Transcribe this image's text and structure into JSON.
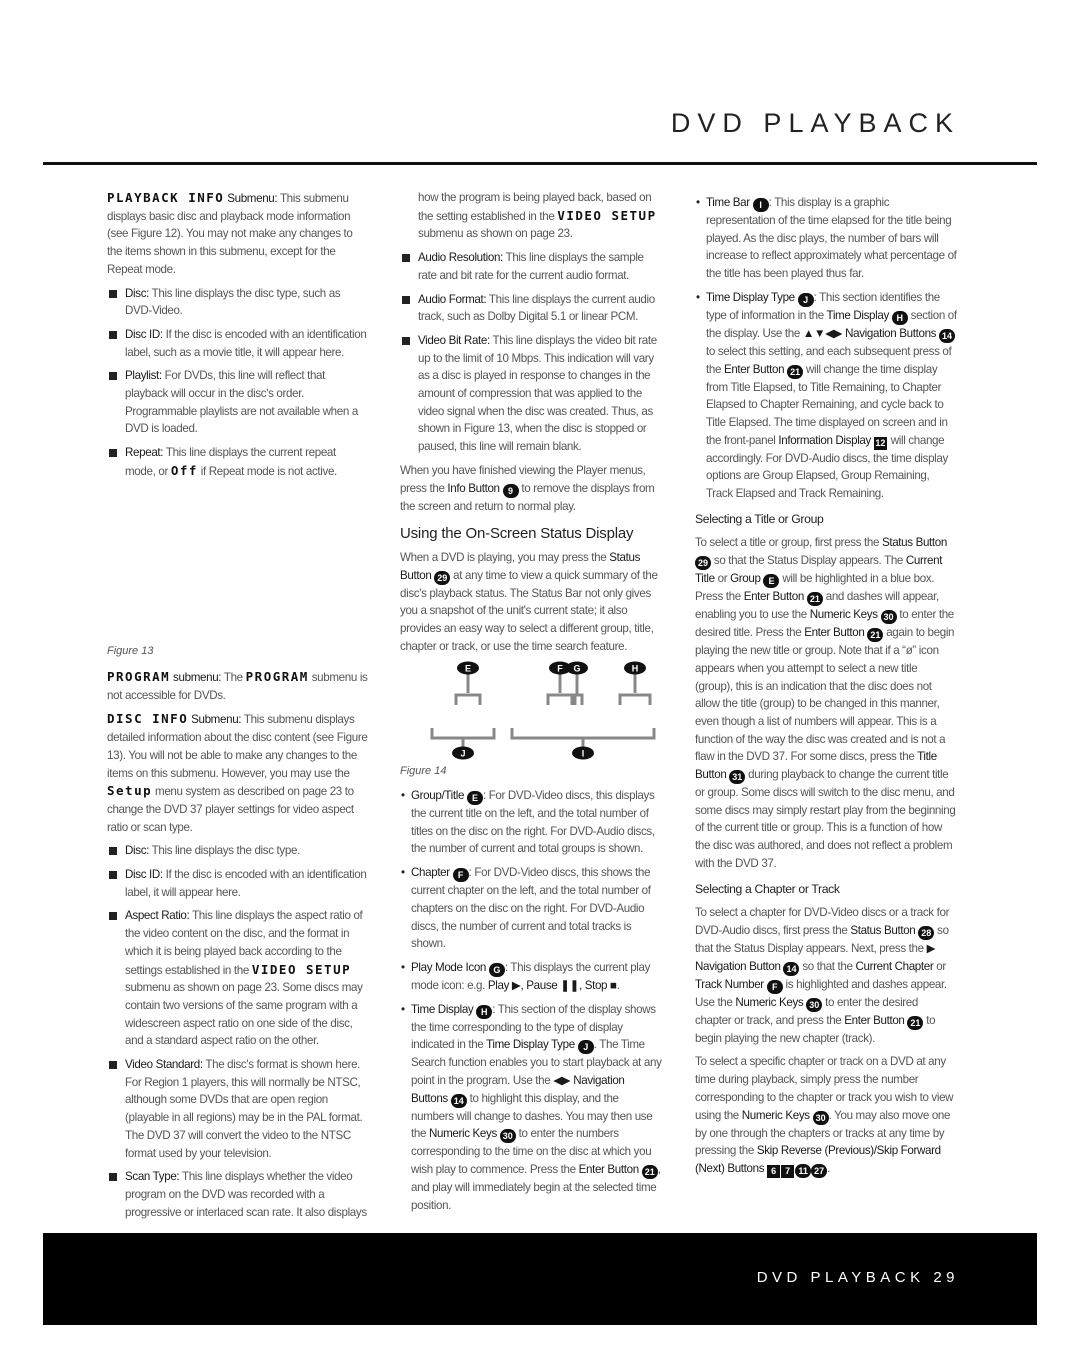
{
  "header": {
    "title": "DVD PLAYBACK"
  },
  "footer": {
    "label": "DVD PLAYBACK   29"
  },
  "figures": {
    "fig13": "Figure 13",
    "fig14": "Figure 14",
    "fig14_labels": [
      "E",
      "F",
      "G",
      "H",
      "J",
      "I"
    ]
  },
  "col1a": [
    {
      "t": "p",
      "s": [
        [
          "m",
          "PLAYBACK INFO"
        ],
        [
          "b",
          " Submenu:"
        ],
        [
          "t",
          " This submenu displays basic disc and playback mode information (see Figure 12). You may not make any changes to the items shown in this submenu, except for the Repeat mode."
        ]
      ]
    },
    {
      "t": "sq",
      "s": [
        [
          "b",
          "Disc:"
        ],
        [
          "t",
          " This line displays the disc type, such as DVD-Video."
        ]
      ]
    },
    {
      "t": "sq",
      "s": [
        [
          "b",
          "Disc ID:"
        ],
        [
          "t",
          " If the disc is encoded with an identification label, such as a movie title, it will appear here."
        ]
      ]
    },
    {
      "t": "sq",
      "s": [
        [
          "b",
          "Playlist:"
        ],
        [
          "t",
          " For DVDs, this line will reflect that playback will occur in the disc's order. Programmable playlists are not available when a DVD is loaded."
        ]
      ]
    },
    {
      "t": "sq",
      "s": [
        [
          "b",
          "Repeat:"
        ],
        [
          "t",
          " This line displays the current repeat mode, or "
        ],
        [
          "m",
          "Off"
        ],
        [
          "t",
          " if Repeat mode is not active."
        ]
      ]
    }
  ],
  "col1b": [
    {
      "t": "p",
      "s": [
        [
          "m",
          "PROGRAM"
        ],
        [
          "b",
          " submenu:"
        ],
        [
          "t",
          " The "
        ],
        [
          "m",
          "PROGRAM"
        ],
        [
          "t",
          " submenu is not accessible for DVDs."
        ]
      ]
    },
    {
      "t": "p",
      "s": [
        [
          "m",
          "DISC INFO"
        ],
        [
          "b",
          " Submenu:"
        ],
        [
          "t",
          " This submenu displays detailed information about the disc content (see Figure 13). You will not be able to make any changes to the items on this submenu. However, you may use the "
        ],
        [
          "m",
          "Setup"
        ],
        [
          "t",
          " menu system as described on page 23 to change the DVD 37 player settings for video aspect ratio or scan type."
        ]
      ]
    },
    {
      "t": "sq",
      "s": [
        [
          "b",
          "Disc:"
        ],
        [
          "t",
          " This line displays the disc type."
        ]
      ]
    },
    {
      "t": "sq",
      "s": [
        [
          "b",
          "Disc ID:"
        ],
        [
          "t",
          " If the disc is encoded with an identification label, it will appear here."
        ]
      ]
    },
    {
      "t": "sq",
      "s": [
        [
          "b",
          "Aspect Ratio:"
        ],
        [
          "t",
          " This line displays the aspect ratio of the video content on the disc, and the format in which it is being played back according to the settings established in the "
        ],
        [
          "m",
          "VIDEO SETUP"
        ],
        [
          "t",
          " submenu as shown on page 23. Some discs may contain two versions of the same program with a widescreen aspect ratio on one side of the disc, and a standard aspect ratio on the other."
        ]
      ]
    },
    {
      "t": "sq",
      "s": [
        [
          "b",
          "Video Standard:"
        ],
        [
          "t",
          " The disc's format is shown here. For Region 1 players, this will normally be NTSC, although some DVDs that are open region (playable in all regions) may be in the PAL format. The DVD 37 will convert the video to the NTSC format used by your television."
        ]
      ]
    },
    {
      "t": "sq",
      "s": [
        [
          "b",
          "Scan Type:"
        ],
        [
          "t",
          " This line displays whether the video program on the DVD was recorded with a progressive or interlaced scan rate. It also displays"
        ]
      ]
    }
  ],
  "col2a": [
    {
      "t": "sqc",
      "s": [
        [
          "t",
          "how the program is being played back, based on the setting established in the "
        ],
        [
          "m",
          "VIDEO SETUP"
        ],
        [
          "t",
          " submenu as shown on page 23."
        ]
      ]
    },
    {
      "t": "sq",
      "s": [
        [
          "b",
          "Audio Resolution:"
        ],
        [
          "t",
          " This line displays the sample rate and bit rate for the current audio format."
        ]
      ]
    },
    {
      "t": "sq",
      "s": [
        [
          "b",
          "Audio Format:"
        ],
        [
          "t",
          " This line displays the current audio track, such as Dolby Digital 5.1 or linear PCM."
        ]
      ]
    },
    {
      "t": "sq",
      "s": [
        [
          "b",
          "Video Bit Rate:"
        ],
        [
          "t",
          " This line displays the video bit rate up to the limit of 10 Mbps. This indication will vary as a disc is played in response to changes in the amount of compression that was applied to the video signal when the disc was created. Thus, as shown in Figure 13, when the disc is stopped or paused, this line will remain blank."
        ]
      ]
    },
    {
      "t": "p",
      "s": [
        [
          "t",
          "When you have finished viewing the Player menus, press the "
        ],
        [
          "b",
          "Info Button"
        ],
        [
          "t",
          " "
        ],
        [
          "k",
          "9"
        ],
        [
          "t",
          " to remove the displays from the screen and return to normal play."
        ]
      ]
    },
    {
      "t": "h2",
      "s": [
        [
          "t",
          "Using the On-Screen Status Display"
        ]
      ]
    },
    {
      "t": "p",
      "s": [
        [
          "t",
          "When a DVD is playing, you may press the "
        ],
        [
          "b",
          "Status Button"
        ],
        [
          "t",
          " "
        ],
        [
          "k",
          "29"
        ],
        [
          "t",
          " at any time to view a quick summary of the disc's playback status. The Status Bar not only gives you a snapshot of the unit's current state; it also provides an easy way to select a different group, title, chapter or track, or use the time search feature."
        ]
      ]
    }
  ],
  "col2b": [
    {
      "t": "dot",
      "s": [
        [
          "b",
          "Group/Title"
        ],
        [
          "t",
          " "
        ],
        [
          "k",
          "E"
        ],
        [
          "t",
          ": For DVD-Video discs, this displays the current title on the left, and the total number of titles on the disc on the right. For DVD-Audio discs, the number of current and total groups is shown."
        ]
      ]
    },
    {
      "t": "dot",
      "s": [
        [
          "b",
          "Chapter"
        ],
        [
          "t",
          " "
        ],
        [
          "k",
          "F"
        ],
        [
          "t",
          ": For DVD-Video discs, this shows the current chapter on the left, and the total number of chapters on the disc on the right. For DVD-Audio discs, the number of current and total tracks is shown."
        ]
      ]
    },
    {
      "t": "dot",
      "s": [
        [
          "b",
          "Play Mode Icon"
        ],
        [
          "t",
          " "
        ],
        [
          "k",
          "G"
        ],
        [
          "t",
          ": This displays the current play mode icon: e.g. "
        ],
        [
          "b",
          "Play ▶, Pause ❚❚, Stop ■"
        ],
        [
          "t",
          "."
        ]
      ]
    },
    {
      "t": "dot",
      "s": [
        [
          "b",
          "Time Display"
        ],
        [
          "t",
          " "
        ],
        [
          "k",
          "H"
        ],
        [
          "t",
          ": This section of the display shows the time corresponding to the type of display indicated in the "
        ],
        [
          "b",
          "Time Display Type"
        ],
        [
          "t",
          " "
        ],
        [
          "k",
          "J"
        ],
        [
          "t",
          ". The Time Search function enables you to start playback at any point in the program. Use the "
        ],
        [
          "b",
          "◀▶ Navigation Buttons"
        ],
        [
          "t",
          " "
        ],
        [
          "k",
          "14"
        ],
        [
          "t",
          " to highlight this display, and the numbers will change to dashes. You may then use the "
        ],
        [
          "b",
          "Numeric Keys"
        ],
        [
          "t",
          " "
        ],
        [
          "k",
          "30"
        ],
        [
          "t",
          " to enter the numbers corresponding to the time on the disc at which you wish play to commence. Press the "
        ],
        [
          "b",
          "Enter Button"
        ],
        [
          "t",
          " "
        ],
        [
          "k",
          "21"
        ],
        [
          "t",
          ", and play will immediately begin at the selected time position."
        ]
      ]
    }
  ],
  "col3": [
    {
      "t": "dot",
      "s": [
        [
          "b",
          "Time Bar"
        ],
        [
          "t",
          " "
        ],
        [
          "k",
          "I"
        ],
        [
          "t",
          ": This display is a graphic representation of the time elapsed for the title being played. As the disc plays, the number of bars will increase to reflect approximately what percentage of the title has been played thus far."
        ]
      ]
    },
    {
      "t": "dot",
      "s": [
        [
          "b",
          "Time Display Type"
        ],
        [
          "t",
          " "
        ],
        [
          "k",
          "J"
        ],
        [
          "t",
          ": This section identifies the type of information in the "
        ],
        [
          "b",
          "Time Display"
        ],
        [
          "t",
          " "
        ],
        [
          "k",
          "H"
        ],
        [
          "t",
          " section of the display. Use the "
        ],
        [
          "b",
          "▲▼◀▶ Navigation Buttons"
        ],
        [
          "t",
          " "
        ],
        [
          "k",
          "14"
        ],
        [
          "t",
          " to select this setting, and each subsequent press of the "
        ],
        [
          "b",
          "Enter Button"
        ],
        [
          "t",
          " "
        ],
        [
          "k",
          "21"
        ],
        [
          "t",
          " will change the time display from Title Elapsed, to Title Remaining, to Chapter Elapsed to Chapter Remaining, and cycle back to Title Elapsed. The time displayed on screen and in the front-panel "
        ],
        [
          "b",
          "Information Display"
        ],
        [
          "t",
          " "
        ],
        [
          "q",
          "12"
        ],
        [
          "t",
          " will change accordingly. For DVD-Audio discs, the time display options are Group Elapsed, Group Remaining, Track Elapsed and Track Remaining."
        ]
      ]
    },
    {
      "t": "h3",
      "s": [
        [
          "t",
          "Selecting a Title or Group"
        ]
      ]
    },
    {
      "t": "p",
      "s": [
        [
          "t",
          "To select a title or group, first press the "
        ],
        [
          "b",
          "Status Button"
        ],
        [
          "t",
          " "
        ],
        [
          "k",
          "29"
        ],
        [
          "t",
          " so that the Status Display appears. The "
        ],
        [
          "b",
          "Current Title"
        ],
        [
          "t",
          " or "
        ],
        [
          "b",
          "Group"
        ],
        [
          "t",
          " "
        ],
        [
          "k",
          "E"
        ],
        [
          "t",
          " will be highlighted in a blue box. Press the "
        ],
        [
          "b",
          "Enter Button"
        ],
        [
          "t",
          " "
        ],
        [
          "k",
          "21"
        ],
        [
          "t",
          " and dashes will appear, enabling you to use the "
        ],
        [
          "b",
          "Numeric Keys"
        ],
        [
          "t",
          " "
        ],
        [
          "k",
          "30"
        ],
        [
          "t",
          " to enter the desired title. Press the "
        ],
        [
          "b",
          "Enter Button"
        ],
        [
          "t",
          " "
        ],
        [
          "k",
          "21"
        ],
        [
          "t",
          " again to begin playing the new title or group. Note that if a “ø” icon appears when you attempt to select a new title (group), this is an indication that the disc does not allow the title (group) to be changed in this manner, even though a list of numbers will appear. This is a function of the way the disc was created and is not a flaw in the DVD 37. For some discs, press the "
        ],
        [
          "b",
          "Title Button"
        ],
        [
          "t",
          " "
        ],
        [
          "k",
          "31"
        ],
        [
          "t",
          " during playback to change the current title or group. Some discs will switch to the disc menu, and some discs may simply restart play from the beginning of the current title or group. This is a function of how the disc was authored, and does not reflect a problem with the DVD 37."
        ]
      ]
    },
    {
      "t": "h3",
      "s": [
        [
          "t",
          "Selecting a Chapter or Track"
        ]
      ]
    },
    {
      "t": "p",
      "s": [
        [
          "t",
          "To select a chapter for DVD-Video discs or a track for DVD-Audio discs, first press the "
        ],
        [
          "b",
          "Status Button"
        ],
        [
          "t",
          " "
        ],
        [
          "k",
          "28"
        ],
        [
          "t",
          " so that the Status Display appears. Next, press the "
        ],
        [
          "b",
          "▶ Navigation Button"
        ],
        [
          "t",
          " "
        ],
        [
          "k",
          "14"
        ],
        [
          "t",
          " so that the "
        ],
        [
          "b",
          "Current Chapter"
        ],
        [
          "t",
          " or "
        ],
        [
          "b",
          "Track Number"
        ],
        [
          "t",
          " "
        ],
        [
          "k",
          "F"
        ],
        [
          "t",
          " is highlighted and dashes appear. Use the "
        ],
        [
          "b",
          "Numeric Keys"
        ],
        [
          "t",
          " "
        ],
        [
          "k",
          "30"
        ],
        [
          "t",
          " to enter the desired chapter or track, and press the "
        ],
        [
          "b",
          "Enter Button"
        ],
        [
          "t",
          " "
        ],
        [
          "k",
          "21"
        ],
        [
          "t",
          " to begin playing the new chapter (track)."
        ]
      ]
    },
    {
      "t": "p",
      "s": [
        [
          "t",
          "To select a specific chapter or track on a DVD at any time during playback, simply press the number corresponding to the chapter or track you wish to view using the "
        ],
        [
          "b",
          "Numeric Keys"
        ],
        [
          "t",
          " "
        ],
        [
          "k",
          "30"
        ],
        [
          "t",
          ". You may also move one by one through the chapters or tracks at any time by pressing the "
        ],
        [
          "b",
          "Skip Reverse (Previous)/Skip Forward (Next) Buttons"
        ],
        [
          "t",
          " "
        ],
        [
          "q",
          "6"
        ],
        [
          "q",
          "7"
        ],
        [
          "k",
          "11"
        ],
        [
          "k",
          "27"
        ],
        [
          "t",
          "."
        ]
      ]
    }
  ]
}
